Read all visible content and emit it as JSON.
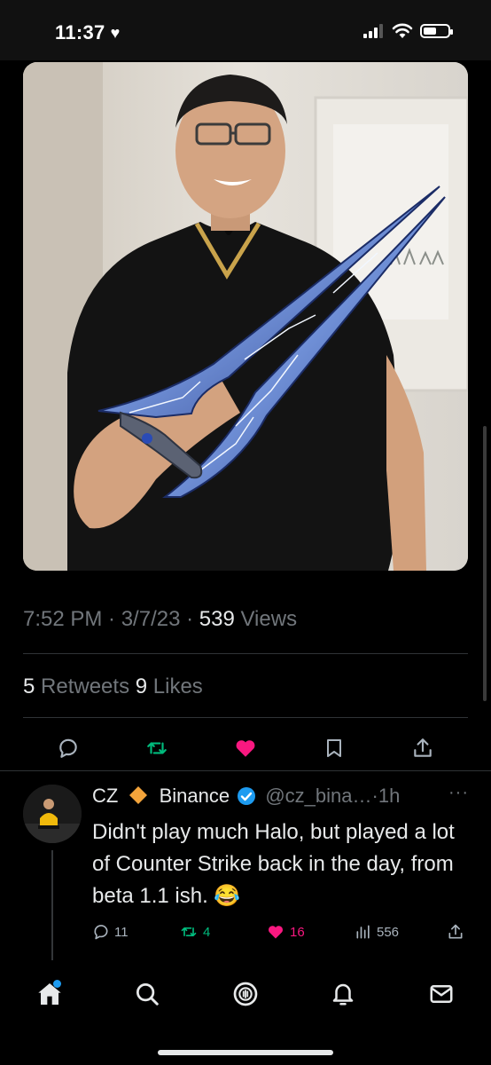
{
  "status_bar": {
    "time": "11:37"
  },
  "tweet": {
    "timestamp": "7:52 PM · 3/7/23 · ",
    "views_count": "539",
    "views_label": " Views",
    "retweets_count": "5",
    "retweets_label": " Retweets ",
    "likes_count": "9",
    "likes_label": " Likes"
  },
  "reply": {
    "name": "CZ",
    "name_suffix": "Binance",
    "handle_time": "@cz_bina…·1h",
    "text": "Didn't play much Halo, but played a lot of Counter Strike back in the day, from beta 1.1 ish. 😂",
    "reply_count": "11",
    "retweet_count": "4",
    "like_count": "16",
    "views_count": "556"
  },
  "colors": {
    "background": "#000000",
    "accent_blue": "#1d9bf0",
    "retweet_green": "#00ba7c",
    "like_pink": "#f91880",
    "muted_text": "#71767b"
  },
  "icons": {
    "action_row": [
      "reply-icon",
      "retweet-icon",
      "like-icon",
      "bookmark-icon",
      "share-icon"
    ],
    "tab_bar": [
      "home-icon",
      "search-icon",
      "spaces-icon",
      "notifications-icon",
      "messages-icon"
    ]
  }
}
